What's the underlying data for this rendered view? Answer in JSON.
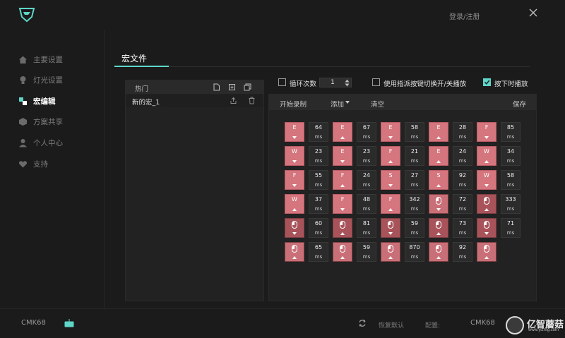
{
  "header": {
    "login_label": "登录/注册"
  },
  "sidebar": {
    "items": [
      {
        "label": "主要设置",
        "icon": "home-icon",
        "active": false
      },
      {
        "label": "灯光设置",
        "icon": "bulb-icon",
        "active": false
      },
      {
        "label": "宏编辑",
        "icon": "macro-icon",
        "active": true
      },
      {
        "label": "方案共享",
        "icon": "cube-icon",
        "active": false
      },
      {
        "label": "个人中心",
        "icon": "person-icon",
        "active": false
      },
      {
        "label": "支持",
        "icon": "heart-icon",
        "active": false
      }
    ]
  },
  "main": {
    "title": "宏文件"
  },
  "file_panel": {
    "header_label": "热门",
    "files": [
      {
        "name": "新的宏_1"
      }
    ]
  },
  "options": {
    "loop_label": "循环次数",
    "loop_count": "1",
    "toggle_label": "使用指派按键切换开/关播放",
    "press_label": "按下时播放",
    "loop_checked": false,
    "toggle_checked": false,
    "press_checked": true
  },
  "editor": {
    "record_label": "开始录制",
    "add_label": "添加",
    "clear_label": "清空",
    "save_label": "保存",
    "ms_unit": "ms",
    "rows": [
      [
        {
          "type": "key",
          "label": "E",
          "dir": "down"
        },
        {
          "type": "delay",
          "value": "64"
        },
        {
          "type": "key",
          "label": "E",
          "dir": "up"
        },
        {
          "type": "delay",
          "value": "67"
        },
        {
          "type": "key",
          "label": "E",
          "dir": "down"
        },
        {
          "type": "delay",
          "value": "58"
        },
        {
          "type": "key",
          "label": "E",
          "dir": "up"
        },
        {
          "type": "delay",
          "value": "28"
        },
        {
          "type": "key",
          "label": "F",
          "dir": "down"
        },
        {
          "type": "delay",
          "value": "85"
        }
      ],
      [
        {
          "type": "key",
          "label": "W",
          "dir": "down"
        },
        {
          "type": "delay",
          "value": "23"
        },
        {
          "type": "key",
          "label": "E",
          "dir": "down"
        },
        {
          "type": "delay",
          "value": "23"
        },
        {
          "type": "key",
          "label": "F",
          "dir": "up"
        },
        {
          "type": "delay",
          "value": "21"
        },
        {
          "type": "key",
          "label": "E",
          "dir": "up"
        },
        {
          "type": "delay",
          "value": "24"
        },
        {
          "type": "key",
          "label": "W",
          "dir": "up"
        },
        {
          "type": "delay",
          "value": "34"
        }
      ],
      [
        {
          "type": "key",
          "label": "F",
          "dir": "down"
        },
        {
          "type": "delay",
          "value": "55"
        },
        {
          "type": "key",
          "label": "F",
          "dir": "up"
        },
        {
          "type": "delay",
          "value": "24"
        },
        {
          "type": "key",
          "label": "S",
          "dir": "down"
        },
        {
          "type": "delay",
          "value": "27"
        },
        {
          "type": "key",
          "label": "S",
          "dir": "up"
        },
        {
          "type": "delay",
          "value": "92"
        },
        {
          "type": "key",
          "label": "W",
          "dir": "down"
        },
        {
          "type": "delay",
          "value": "58"
        }
      ],
      [
        {
          "type": "key",
          "label": "W",
          "dir": "up"
        },
        {
          "type": "delay",
          "value": "37"
        },
        {
          "type": "key",
          "label": "F",
          "dir": "down"
        },
        {
          "type": "delay",
          "value": "48"
        },
        {
          "type": "key",
          "label": "F",
          "dir": "up"
        },
        {
          "type": "delay",
          "value": "342"
        },
        {
          "type": "mouse",
          "dir": "down",
          "shade": "light"
        },
        {
          "type": "delay",
          "value": "72"
        },
        {
          "type": "mouse",
          "dir": "up",
          "shade": "dark"
        },
        {
          "type": "delay",
          "value": "333"
        }
      ],
      [
        {
          "type": "mouse",
          "dir": "down",
          "shade": "dark"
        },
        {
          "type": "delay",
          "value": "60"
        },
        {
          "type": "mouse",
          "dir": "up",
          "shade": "dark"
        },
        {
          "type": "delay",
          "value": "81"
        },
        {
          "type": "mouse",
          "dir": "down",
          "shade": "dark"
        },
        {
          "type": "delay",
          "value": "59"
        },
        {
          "type": "mouse",
          "dir": "up",
          "shade": "dark"
        },
        {
          "type": "delay",
          "value": "73"
        },
        {
          "type": "mouse",
          "dir": "down",
          "shade": "dark"
        },
        {
          "type": "delay",
          "value": "71"
        }
      ],
      [
        {
          "type": "mouse",
          "dir": "up",
          "shade": "light"
        },
        {
          "type": "delay",
          "value": "65"
        },
        {
          "type": "mouse",
          "dir": "up",
          "shade": "light"
        },
        {
          "type": "delay",
          "value": "59"
        },
        {
          "type": "mouse",
          "dir": "up",
          "shade": "light"
        },
        {
          "type": "delay",
          "value": "870"
        },
        {
          "type": "mouse",
          "dir": "up",
          "shade": "light"
        },
        {
          "type": "delay",
          "value": "92"
        },
        {
          "type": "mouse",
          "dir": "up",
          "shade": "light"
        }
      ]
    ]
  },
  "footer": {
    "device_name": "CMK68",
    "restore_label": "恢复默认",
    "config_label": "配置:",
    "profile_name": "CMK68"
  },
  "watermark": {
    "brand": "亿智蘑菇",
    "url": "www.yizmg.com"
  },
  "colors": {
    "accent": "#5ed6c8",
    "key_fill": "#d5757e",
    "mouse_fill": "#a8535a"
  }
}
